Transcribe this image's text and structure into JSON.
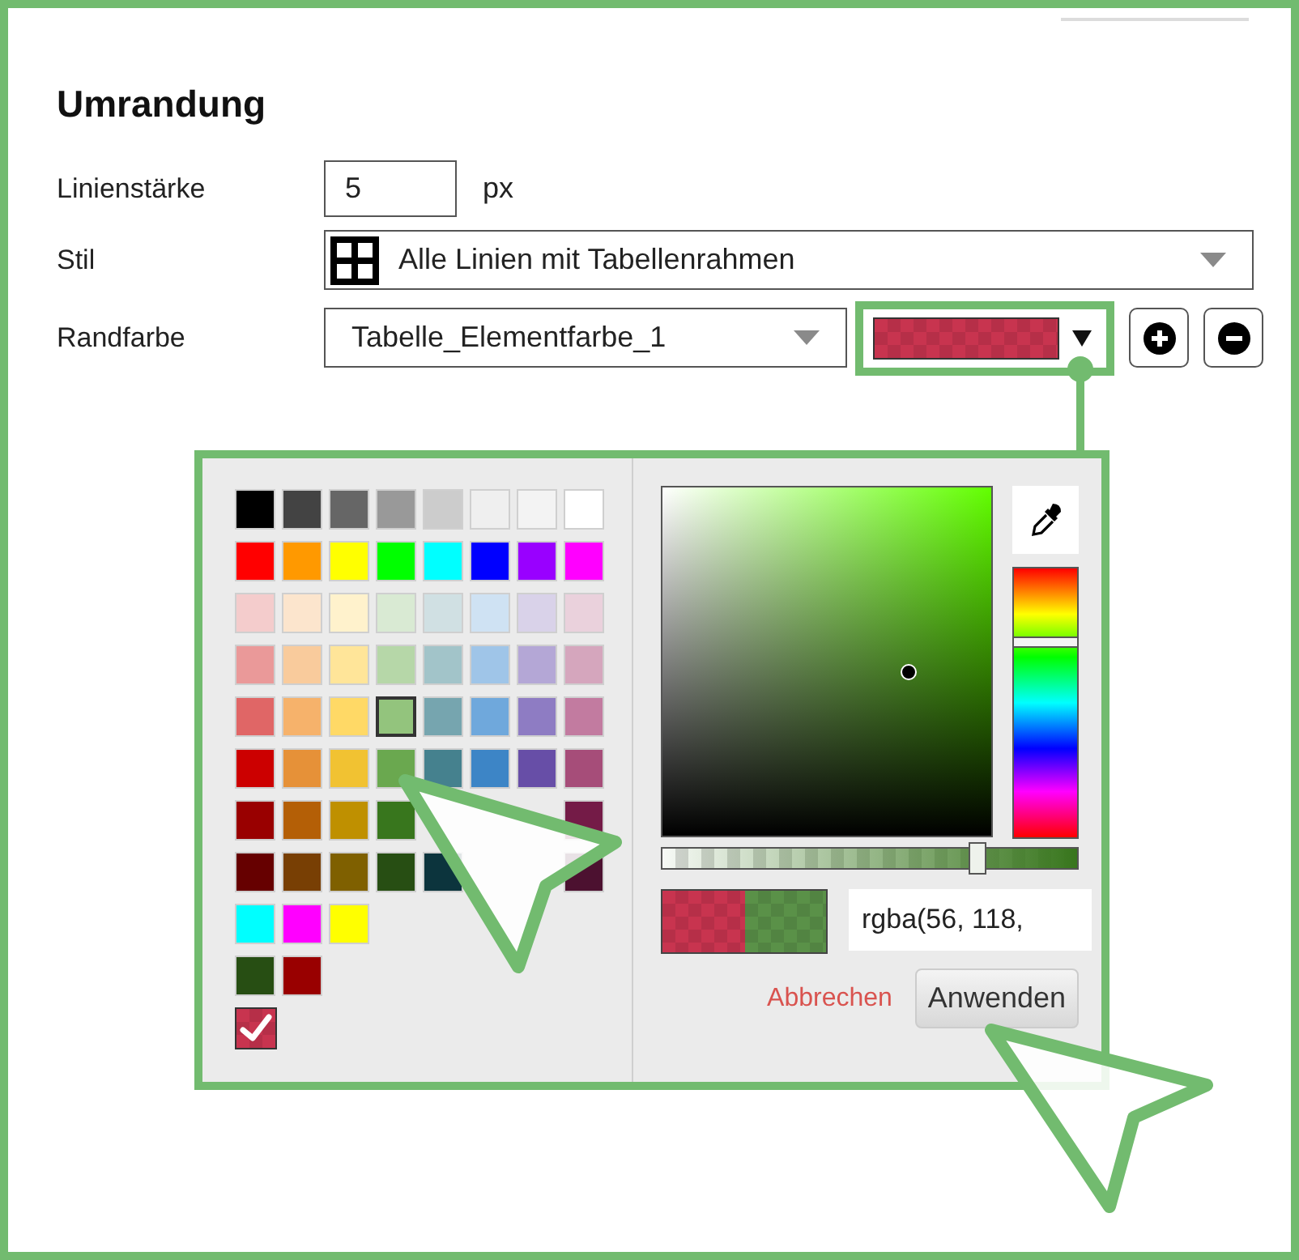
{
  "section": {
    "title": "Umrandung"
  },
  "fields": [
    {
      "kind": "number",
      "label": "Linienstärke",
      "value": "5",
      "unit": "px"
    },
    {
      "kind": "select",
      "label": "Stil",
      "value": "Alle Linien mit Tabellenrahmen"
    },
    {
      "kind": "color-select",
      "label": "Randfarbe",
      "value": "Tabelle_Elementfarbe_1",
      "highlighted": true,
      "actions": [
        {
          "kind": "add"
        },
        {
          "kind": "remove"
        }
      ]
    }
  ],
  "color_picker": {
    "palette": [
      {
        "swatches": [
          {
            "color": "#000000",
            "selected": false
          },
          {
            "color": "#434343",
            "selected": false
          },
          {
            "color": "#666666",
            "selected": false
          },
          {
            "color": "#999999",
            "selected": false
          },
          {
            "color": "#cccccc",
            "selected": false
          },
          {
            "color": "#efefef",
            "selected": false
          },
          {
            "color": "#f3f3f3",
            "selected": false
          },
          {
            "color": "#ffffff",
            "selected": false
          }
        ]
      },
      {
        "swatches": [
          {
            "color": "#ff0000",
            "selected": false
          },
          {
            "color": "#ff9900",
            "selected": false
          },
          {
            "color": "#ffff00",
            "selected": false
          },
          {
            "color": "#00ff00",
            "selected": false
          },
          {
            "color": "#00ffff",
            "selected": false
          },
          {
            "color": "#0000ff",
            "selected": false
          },
          {
            "color": "#9900ff",
            "selected": false
          },
          {
            "color": "#ff00ff",
            "selected": false
          }
        ]
      },
      {
        "swatches": [
          {
            "color": "#f4cccc",
            "selected": false
          },
          {
            "color": "#fce5cd",
            "selected": false
          },
          {
            "color": "#fff2cc",
            "selected": false
          },
          {
            "color": "#d9ead3",
            "selected": false
          },
          {
            "color": "#d0e0e3",
            "selected": false
          },
          {
            "color": "#cfe2f3",
            "selected": false
          },
          {
            "color": "#d9d2e9",
            "selected": false
          },
          {
            "color": "#ead1dc",
            "selected": false
          }
        ]
      },
      {
        "swatches": [
          {
            "color": "#ea9999",
            "selected": false
          },
          {
            "color": "#f9cb9c",
            "selected": false
          },
          {
            "color": "#ffe599",
            "selected": false
          },
          {
            "color": "#b6d7a8",
            "selected": false
          },
          {
            "color": "#a2c4c9",
            "selected": false
          },
          {
            "color": "#9fc5e8",
            "selected": false
          },
          {
            "color": "#b4a7d6",
            "selected": false
          },
          {
            "color": "#d5a6bd",
            "selected": false
          }
        ]
      },
      {
        "swatches": [
          {
            "color": "#e06666",
            "selected": false
          },
          {
            "color": "#f6b26b",
            "selected": false
          },
          {
            "color": "#ffd966",
            "selected": false
          },
          {
            "color": "#93c47d",
            "selected": true
          },
          {
            "color": "#76a5af",
            "selected": false
          },
          {
            "color": "#6fa8dc",
            "selected": false
          },
          {
            "color": "#8e7cc3",
            "selected": false
          },
          {
            "color": "#c27ba0",
            "selected": false
          }
        ]
      },
      {
        "swatches": [
          {
            "color": "#cc0000",
            "selected": false
          },
          {
            "color": "#e69138",
            "selected": false
          },
          {
            "color": "#f1c232",
            "selected": false
          },
          {
            "color": "#6aa84f",
            "selected": false
          },
          {
            "color": "#45818e",
            "selected": false
          },
          {
            "color": "#3d85c6",
            "selected": false
          },
          {
            "color": "#674ea7",
            "selected": false
          },
          {
            "color": "#a64d79",
            "selected": false
          }
        ]
      },
      {
        "swatches": [
          {
            "color": "#990000",
            "selected": false
          },
          {
            "color": "#b45f06",
            "selected": false
          },
          {
            "color": "#bf9000",
            "selected": false
          },
          {
            "color": "#38761d",
            "selected": false
          },
          {
            "kind": "covered"
          },
          {
            "kind": "covered"
          },
          {
            "kind": "covered"
          },
          {
            "color": "#741b47",
            "selected": false
          }
        ]
      },
      {
        "swatches": [
          {
            "color": "#660000",
            "selected": false
          },
          {
            "color": "#783f04",
            "selected": false
          },
          {
            "color": "#7f6000",
            "selected": false
          },
          {
            "color": "#274e13",
            "selected": false
          },
          {
            "color": "#0c343d",
            "selected": false
          },
          {
            "kind": "covered"
          },
          {
            "kind": "covered"
          },
          {
            "color": "#4c1130",
            "selected": false
          }
        ]
      },
      {
        "swatches": [
          {
            "color": "#00ffff",
            "selected": false
          },
          {
            "color": "#ff00ff",
            "selected": false
          },
          {
            "color": "#ffff00",
            "selected": false
          }
        ]
      },
      {
        "swatches": [
          {
            "color": "#274e13",
            "selected": false
          },
          {
            "color": "#990000",
            "selected": false
          }
        ]
      }
    ],
    "current": {
      "color": "#c8344f",
      "checked": true
    },
    "alpha": {
      "level": 0.75
    },
    "value": "rgba(56, 118,",
    "actions": [
      {
        "kind": "cancel",
        "label": "Abbrechen"
      },
      {
        "kind": "apply",
        "label": "Anwenden"
      }
    ]
  }
}
